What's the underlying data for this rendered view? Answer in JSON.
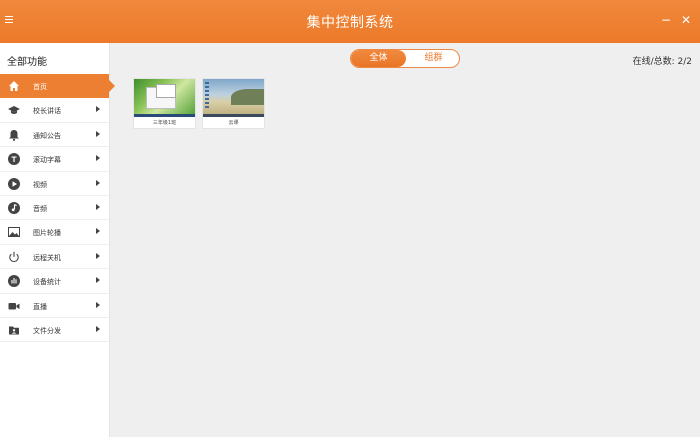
{
  "window": {
    "title": "集中控制系统",
    "minimize_glyph": "−",
    "close_glyph": "✕"
  },
  "sidebar": {
    "header": "全部功能",
    "items": [
      {
        "label": "首页",
        "icon": "home-icon",
        "active": true
      },
      {
        "label": "校长讲话",
        "icon": "graduation-cap-icon"
      },
      {
        "label": "通知公告",
        "icon": "bell-icon"
      },
      {
        "label": "滚动字幕",
        "icon": "text-t-icon"
      },
      {
        "label": "视频",
        "icon": "play-icon"
      },
      {
        "label": "音频",
        "icon": "music-note-icon"
      },
      {
        "label": "图片轮播",
        "icon": "image-icon"
      },
      {
        "label": "远程关机",
        "icon": "power-icon"
      },
      {
        "label": "设备统计",
        "icon": "stats-icon"
      },
      {
        "label": "直播",
        "icon": "video-camera-icon"
      },
      {
        "label": "文件分发",
        "icon": "file-share-icon"
      }
    ]
  },
  "toolbar": {
    "all_label": "全体",
    "group_label": "组群",
    "online_status": "在线/总数:  2/2"
  },
  "devices": [
    {
      "name": "三年级1班"
    },
    {
      "name": "云课"
    }
  ],
  "colors": {
    "accent": "#ec7a2a",
    "sidebar_bg": "#ffffff",
    "content_bg": "#efefef"
  }
}
